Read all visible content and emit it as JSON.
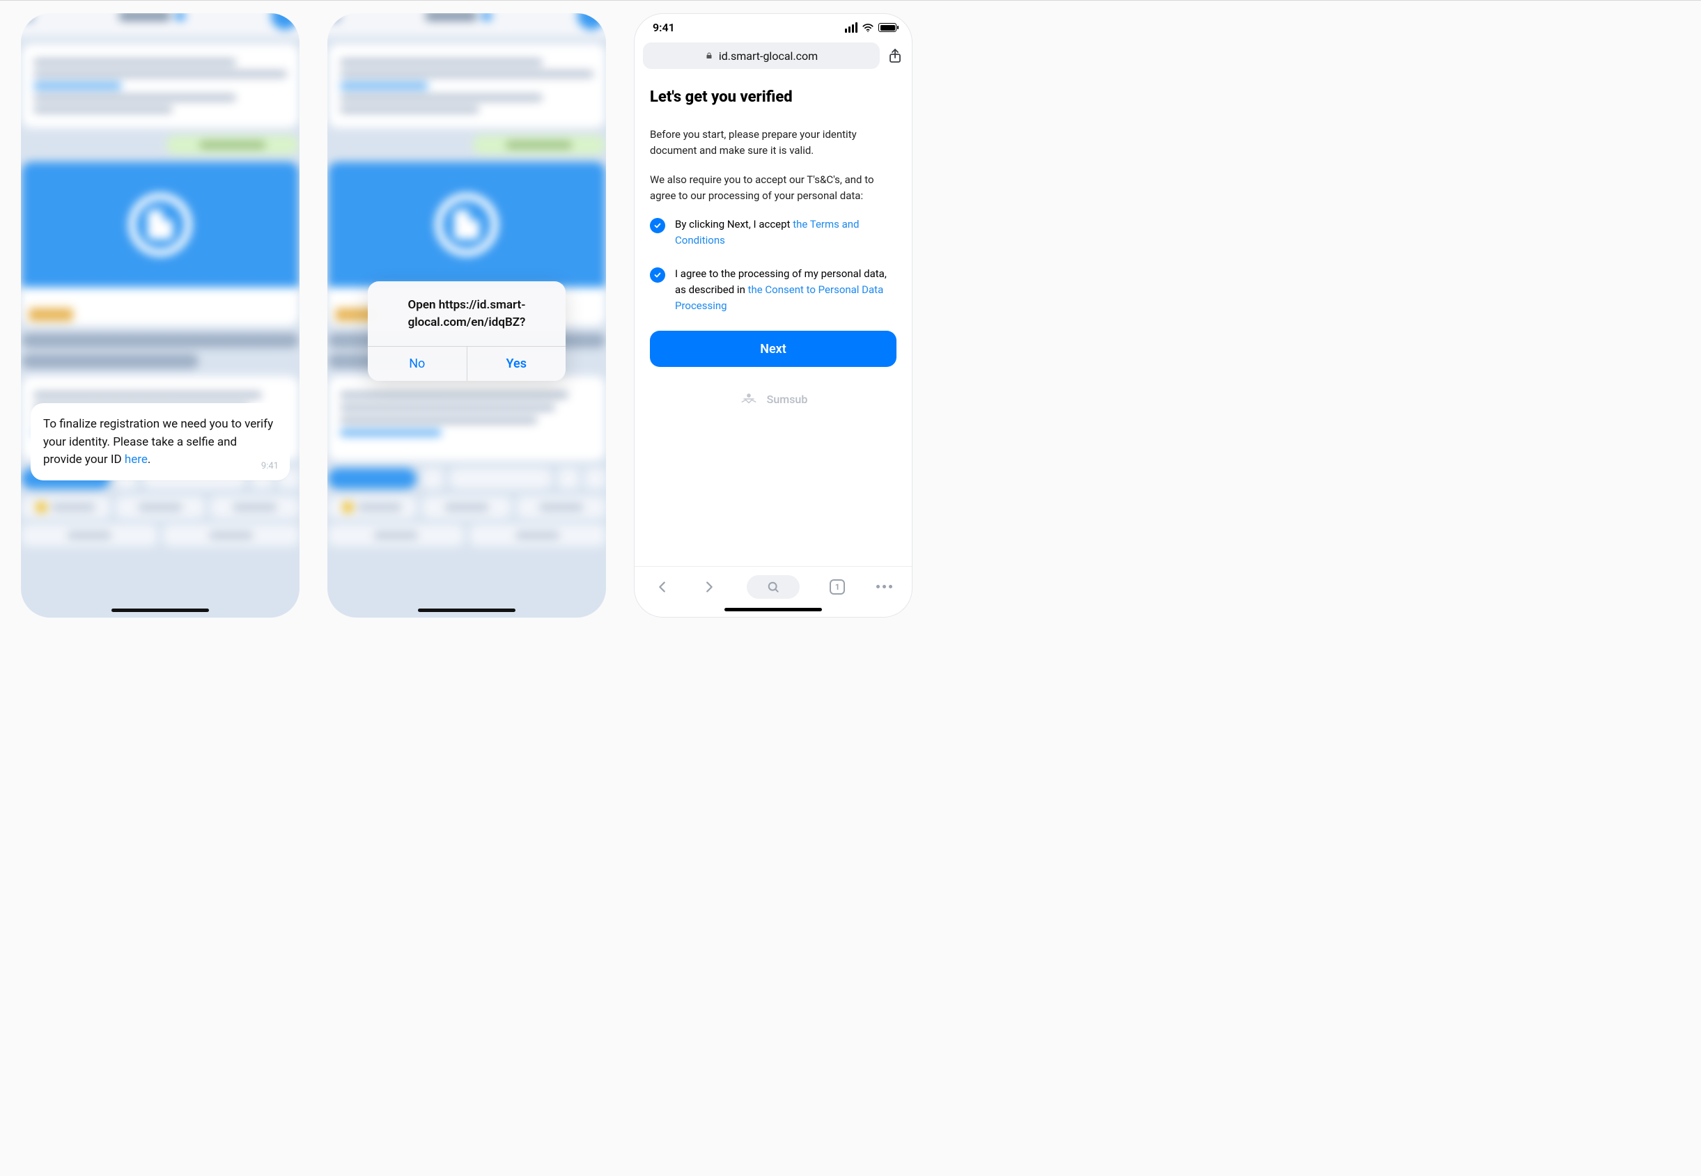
{
  "phone1": {
    "message_text_pre": "To finalize registration we need you to verify your identity. Please take a selfie and provide your ID ",
    "message_link": "here",
    "message_text_post": ".",
    "time": "9:41"
  },
  "phone2": {
    "alert_text": "Open https://id.smart-glocal.com/en/idqBZ?",
    "no": "No",
    "yes": "Yes"
  },
  "phone3": {
    "time": "9:41",
    "url": "id.smart-glocal.com",
    "heading": "Let's get you verified",
    "p1": "Before you start, please prepare your identity document and make sure it is valid.",
    "p2": "We also require you to accept our T's&C's, and to agree to our processing of your personal data:",
    "accept_pre": "By clicking Next, I accept ",
    "accept_link": "the Terms and Conditions",
    "consent_pre": "I agree to the processing of my personal data, as described in ",
    "consent_link": "the Consent to Personal Data Processing",
    "next": "Next",
    "brand": "Sumsub",
    "tabs_count": "1"
  }
}
